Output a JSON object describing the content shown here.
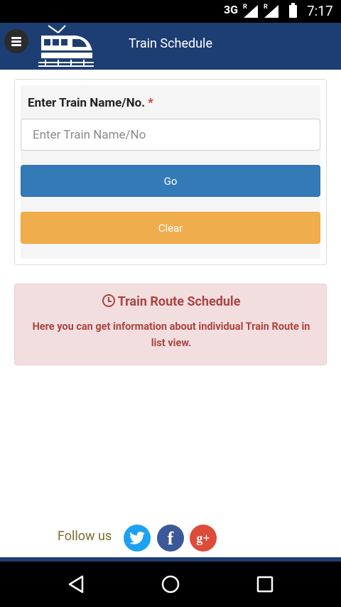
{
  "status_bar": {
    "network": "3G",
    "roaming_1": "R",
    "roaming_2": "R",
    "time": "7:17"
  },
  "app_bar": {
    "title": "Train Schedule",
    "menu_icon": "hamburger-menu-icon",
    "logo_icon": "train-icon",
    "bg_color": "#1d3e72"
  },
  "form": {
    "label": "Enter Train Name/No.",
    "required_mark": "*",
    "input_value": "",
    "input_placeholder": "Enter Train Name/No",
    "go_label": "Go",
    "clear_label": "Clear",
    "go_color": "#337ab7",
    "clear_color": "#f0ad4e"
  },
  "info": {
    "title": "Train Route Schedule",
    "icon": "clock-icon",
    "text": "Here you can get information about individual Train Route in list view."
  },
  "footer": {
    "follow_label": "Follow us",
    "social": [
      {
        "name": "twitter-icon"
      },
      {
        "name": "facebook-icon",
        "glyph": "f"
      },
      {
        "name": "google-plus-icon",
        "glyph": "g+"
      }
    ]
  },
  "nav_bar": {
    "back": "back-icon",
    "home": "home-icon",
    "recents": "recents-icon"
  }
}
